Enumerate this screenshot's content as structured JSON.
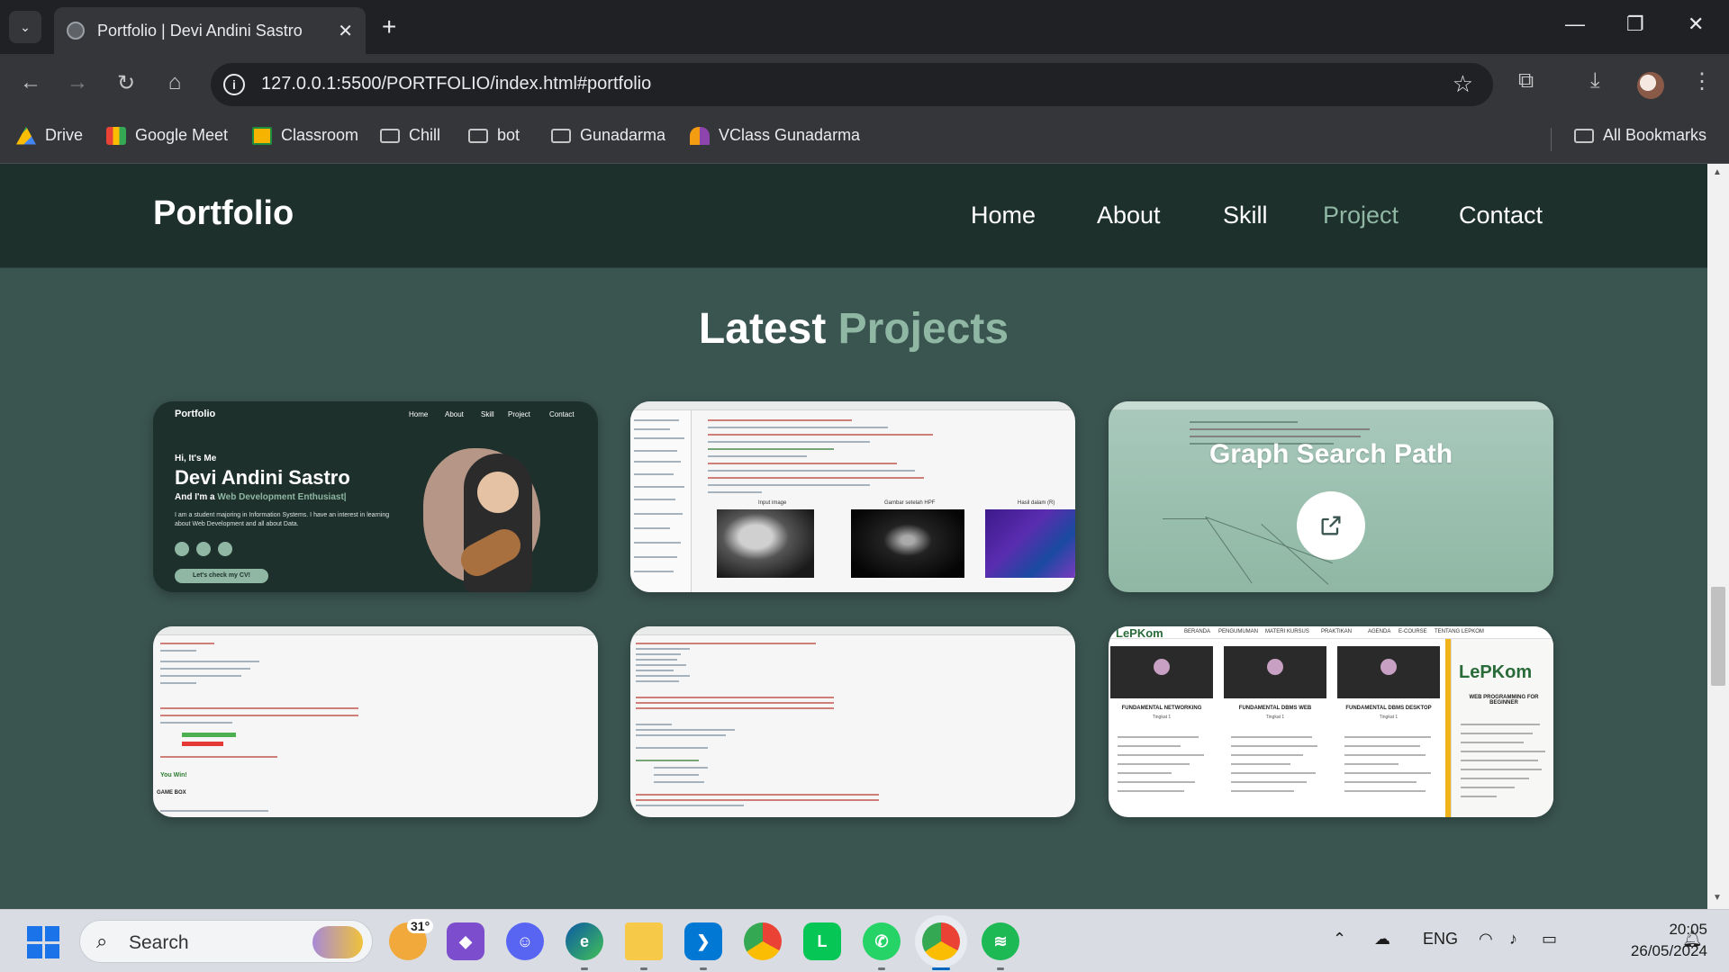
{
  "browser": {
    "tab_title": "Portfolio | Devi Andini Sastro",
    "url": "127.0.0.1:5500/PORTFOLIO/index.html#portfolio",
    "bookmarks": [
      "Drive",
      "Google Meet",
      "Classroom",
      "Chill",
      "bot",
      "Gunadarma",
      "VClass Gunadarma"
    ],
    "all_bookmarks": "All Bookmarks"
  },
  "site": {
    "logo": "Portfolio",
    "nav": [
      "Home",
      "About",
      "Skill",
      "Project",
      "Contact"
    ],
    "active_nav": "Project",
    "section_title_main": "Latest ",
    "section_title_accent": "Projects"
  },
  "projects": {
    "card1": {
      "mini_logo": "Portfolio",
      "mini_nav": [
        "Home",
        "About",
        "Skill",
        "Project",
        "Contact"
      ],
      "greeting": "Hi, It's Me",
      "name": "Devi Andini Sastro",
      "role_prefix": "And I'm a ",
      "role_accent": "Web Development Enthusiast|",
      "description": "I am a student majoring in Information Systems. I have an interest in learning about Web Development and all about Data.",
      "cv_button": "Let's check my CV!"
    },
    "card2": {
      "labels": [
        "Input image",
        "Gambar setelah HPF",
        "Hasil dalam (R)"
      ]
    },
    "card3": {
      "overlay_title": "Graph Search Path"
    },
    "card4": {
      "result_text": "You Win!",
      "section_text": "GAME BOX"
    },
    "card6": {
      "logo": "LePKom",
      "menu": [
        "BERANDA",
        "PENGUMUMAN",
        "MATERI KURSUS",
        "PRAKTIKAN",
        "AGENDA",
        "E-COURSE",
        "TENTANG LEPKOM"
      ],
      "courses": [
        {
          "title": "FUNDAMENTAL NETWORKING",
          "sub": "Tingkat 1"
        },
        {
          "title": "FUNDAMENTAL DBMS WEB",
          "sub": "Tingkat 1"
        },
        {
          "title": "FUNDAMENTAL DBMS DESKTOP",
          "sub": "Tingkat 1"
        }
      ],
      "side_logo": "LePKom",
      "side_title": "WEB PROGRAMMING FOR BEGINNER"
    }
  },
  "taskbar": {
    "search_label": "Search",
    "weather_temp": "31°",
    "language": "ENG",
    "time": "20:05",
    "date": "26/05/2024"
  }
}
